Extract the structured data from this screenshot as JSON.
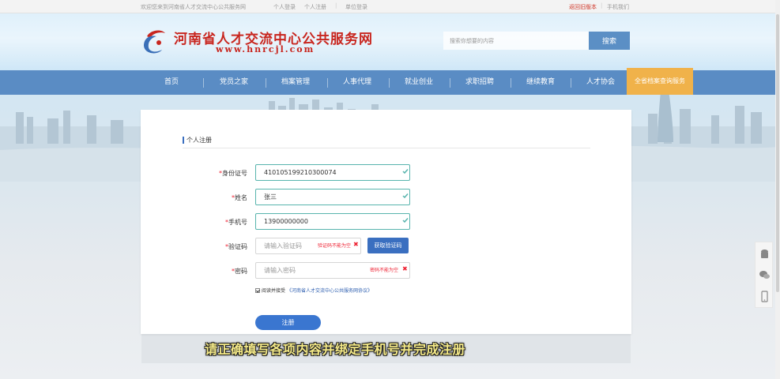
{
  "topbar": {
    "welcome": "欢迎您来到河南省人才交流中心公共服务网",
    "personal_login": "个人登录",
    "personal_register": "个人注册",
    "org_login": "单位登录",
    "old_version": "返回旧版本",
    "mobile": "手机我们"
  },
  "header": {
    "site_title": "河南省人才交流中心公共服务网",
    "site_url": "www.hnrcjl.com",
    "search_placeholder": "搜索你想要的内容",
    "search_button": "搜索"
  },
  "nav": {
    "items": [
      "首页",
      "党员之家",
      "档案管理",
      "人事代理",
      "就业创业",
      "求职招聘",
      "继续教育",
      "人才协会"
    ],
    "active_item": "全省档案查询服务"
  },
  "form": {
    "section_title": "个人注册",
    "id_label": "身份证号",
    "id_value": "410105199210300074",
    "name_label": "姓名",
    "name_value": "张三",
    "phone_label": "手机号",
    "phone_value": "13900000000",
    "code_label": "验证码",
    "code_placeholder": "请输入验证码",
    "code_error": "验证码不能为空",
    "sms_button": "获取验证码",
    "password_label": "密码",
    "password_placeholder": "请输入密码",
    "password_error": "密码不能为空",
    "agree_text": "阅读并接受",
    "agree_link": "《河南省人才交流中心公共服务网协议》",
    "register_button": "注册"
  },
  "subtitle": "请正确填写各项内容并绑定手机号并完成注册",
  "colors": {
    "nav_bg": "#5a8cc4",
    "nav_active": "#f0b24a",
    "brand_red": "#c8261f",
    "primary_button": "#3a6fc0",
    "valid_border": "#58b4ad",
    "error": "#e23"
  },
  "icons": {
    "side_tools": [
      "android-icon",
      "wechat-icon",
      "mobile-icon"
    ]
  }
}
